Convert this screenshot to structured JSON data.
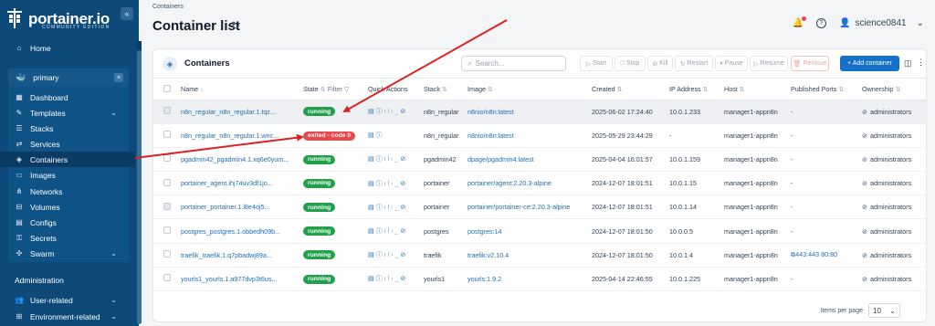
{
  "app": {
    "logo_text": "portainer.io",
    "logo_sub": "COMMUNITY EDITION",
    "collapse_glyph": "«"
  },
  "sidebar": {
    "home": "Home",
    "environment": "primary",
    "environment_close": "×",
    "items": [
      {
        "label": "Dashboard",
        "icon": "dashboard-icon"
      },
      {
        "label": "Templates",
        "icon": "templates-icon",
        "expandable": true
      },
      {
        "label": "Stacks",
        "icon": "stacks-icon"
      },
      {
        "label": "Services",
        "icon": "services-icon"
      },
      {
        "label": "Containers",
        "icon": "containers-icon",
        "active": true
      },
      {
        "label": "Images",
        "icon": "images-icon"
      },
      {
        "label": "Networks",
        "icon": "networks-icon"
      },
      {
        "label": "Volumes",
        "icon": "volumes-icon"
      },
      {
        "label": "Configs",
        "icon": "configs-icon"
      },
      {
        "label": "Secrets",
        "icon": "secrets-icon"
      },
      {
        "label": "Swarm",
        "icon": "swarm-icon",
        "expandable": true
      }
    ],
    "section": "Administration",
    "admin_items": [
      {
        "label": "User-related",
        "icon": "users-icon",
        "expandable": true
      },
      {
        "label": "Environment-related",
        "icon": "environment-icon",
        "expandable": true
      }
    ]
  },
  "header": {
    "breadcrumb": "Containers",
    "title": "Container list",
    "username": "science0841"
  },
  "card": {
    "title": "Containers",
    "search_placeholder": "Search...",
    "buttons": {
      "start": "Start",
      "stop": "Stop",
      "kill": "Kill",
      "restart": "Restart",
      "pause": "Pause",
      "resume": "Resume",
      "remove": "Remove",
      "add": "+ Add container"
    }
  },
  "table": {
    "columns": {
      "name": "Name",
      "state": "State",
      "filter": "Filter",
      "quick_actions": "Quick Actions",
      "stack": "Stack",
      "image": "Image",
      "created": "Created",
      "ip": "IP Address",
      "host": "Host",
      "ports": "Published Ports",
      "ownership": "Ownership"
    },
    "rows": [
      {
        "name": "n8n_regular_n8n_regular.1.tqz...",
        "state": "running",
        "stack": "n8n_regular",
        "image": "n8nio/n8n:latest",
        "created": "2025-06-02 17:24:40",
        "ip": "10.0.1.233",
        "host": "manager1-appn8n",
        "ports": "-",
        "owner": "administrators"
      },
      {
        "name": "n8n_regular_n8n_regular.1.wnc...",
        "state": "exited - code 0",
        "stack": "n8n_regular",
        "image": "n8nio/n8n:latest",
        "created": "2025-05-29 23:44:29",
        "ip": "-",
        "host": "manager1-appn8n",
        "ports": "-",
        "owner": "administrators"
      },
      {
        "name": "pgadmin42_pgadmin4.1.xq6e0yum...",
        "state": "running",
        "stack": "pgadmin42",
        "image": "dpage/pgadmin4:latest",
        "created": "2025-04-04 16:01:57",
        "ip": "10.0.1.159",
        "host": "manager1-appn8n",
        "ports": "-",
        "owner": "administrators"
      },
      {
        "name": "portainer_agent.ihj74uv3df1jo...",
        "state": "running",
        "stack": "portainer",
        "image": "portainer/agent:2.20.3-alpine",
        "created": "2024-12-07 18:01:51",
        "ip": "10.0.1.15",
        "host": "manager1-appn8n",
        "ports": "-",
        "owner": "administrators"
      },
      {
        "name": "portainer_portainer.1.l8e4oj5...",
        "state": "running",
        "stack": "portainer",
        "image": "portainer/portainer-ce:2.20.3-alpine",
        "created": "2024-12-07 18:01:51",
        "ip": "10.0.1.14",
        "host": "manager1-appn8n",
        "ports": "-",
        "owner": "administrators"
      },
      {
        "name": "postgres_postgres.1.obbedh09b...",
        "state": "running",
        "stack": "postgres",
        "image": "postgres:14",
        "created": "2024-12-07 18:01:50",
        "ip": "10.0.0.5",
        "host": "manager1-appn8n",
        "ports": "-",
        "owner": "administrators"
      },
      {
        "name": "traefik_traefik.1.q7pbadwj89a...",
        "state": "running",
        "stack": "traefik",
        "image": "traefik:v2.10.4",
        "created": "2024-12-07 18:01:50",
        "ip": "10.0.1.4",
        "host": "manager1-appn8n",
        "ports": "443:443  80:80",
        "owner": "administrators"
      },
      {
        "name": "yourls1_yourls.1.a977dvp3t6us...",
        "state": "running",
        "stack": "yourls1",
        "image": "yourls:1.9.2",
        "created": "2025-04-14 22:46:55",
        "ip": "10.0.1.225",
        "host": "manager1-appn8n",
        "ports": "-",
        "owner": "administrators"
      }
    ]
  },
  "footer": {
    "items_per_page_label": "Items per page",
    "items_per_page": "10"
  },
  "colors": {
    "sidebar_bg": "#0d4a7a",
    "running": "#20a04b",
    "exited": "#e5484d",
    "primary": "#1570c8",
    "arrow": "#e02020"
  }
}
